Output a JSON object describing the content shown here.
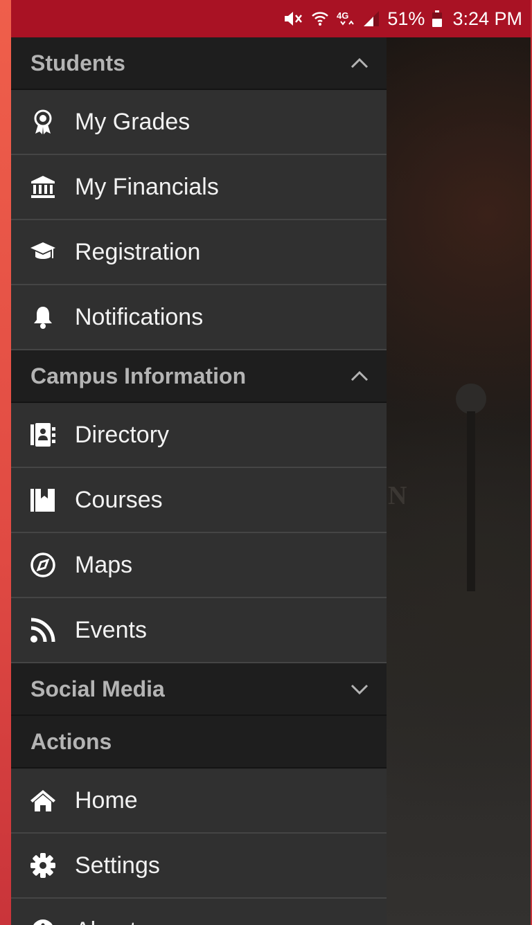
{
  "status_bar": {
    "battery_text": "51%",
    "time": "3:24 PM",
    "icons": [
      "mute-icon",
      "wifi-icon",
      "4g-lte-icon",
      "signal-icon",
      "battery-icon"
    ]
  },
  "colors": {
    "status_bar_bg": "#a91224",
    "drawer_bg": "#303030",
    "section_header_bg": "#1e1e1e",
    "section_header_text": "#b4b4b4",
    "item_text": "#f2f2f2",
    "frame_red": "#e2524a"
  },
  "drawer": {
    "sections": {
      "students": {
        "title": "Students",
        "expanded": true,
        "items": [
          {
            "label": "My Grades",
            "icon": "award-ribbon-icon"
          },
          {
            "label": "My Financials",
            "icon": "bank-icon"
          },
          {
            "label": "Registration",
            "icon": "graduation-cap-icon"
          },
          {
            "label": "Notifications",
            "icon": "bell-icon"
          }
        ]
      },
      "campus": {
        "title": "Campus Information",
        "expanded": true,
        "items": [
          {
            "label": "Directory",
            "icon": "contact-book-icon"
          },
          {
            "label": "Courses",
            "icon": "book-bookmark-icon"
          },
          {
            "label": "Maps",
            "icon": "compass-icon"
          },
          {
            "label": "Events",
            "icon": "rss-feed-icon"
          }
        ]
      },
      "social": {
        "title": "Social Media",
        "expanded": false
      },
      "actions": {
        "title": "Actions",
        "items": [
          {
            "label": "Home",
            "icon": "home-icon"
          },
          {
            "label": "Settings",
            "icon": "gear-icon"
          },
          {
            "label": "About",
            "icon": "info-icon"
          }
        ]
      }
    }
  },
  "background": {
    "partial_text": "N"
  }
}
